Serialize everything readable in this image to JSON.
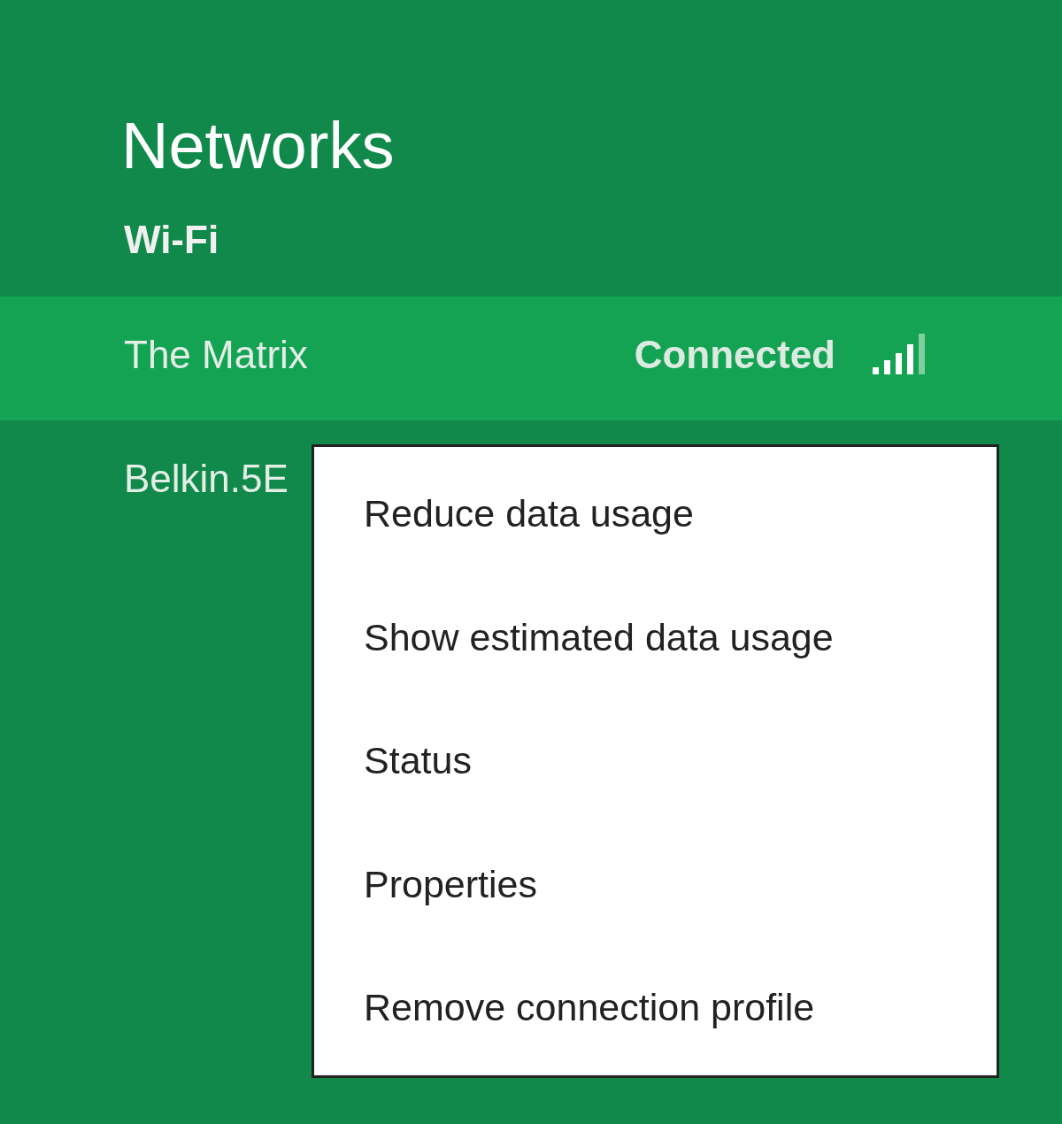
{
  "title": "Networks",
  "section": "Wi-Fi",
  "networks": [
    {
      "name": "The Matrix",
      "status": "Connected",
      "selected": true
    },
    {
      "name": "Belkin.5E",
      "selected": false
    }
  ],
  "context_menu": {
    "items": [
      {
        "label": "Reduce data usage"
      },
      {
        "label": "Show estimated data usage"
      },
      {
        "label": "Status"
      },
      {
        "label": "Properties"
      },
      {
        "label": "Remove connection profile"
      }
    ]
  }
}
